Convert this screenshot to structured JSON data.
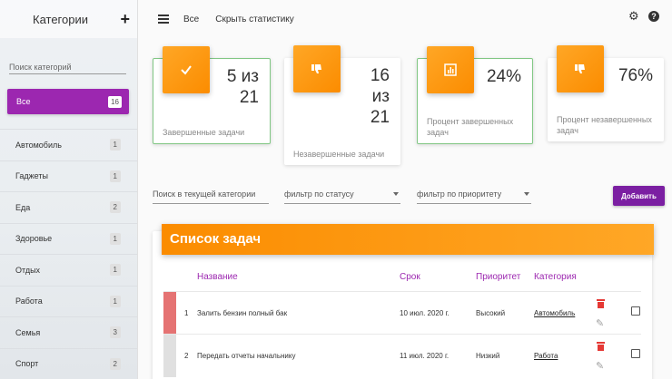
{
  "sidebar": {
    "title": "Категории",
    "add_icon": "plus-icon",
    "search_placeholder": "Поиск категорий",
    "all": {
      "label": "Все",
      "count": "16"
    },
    "items": [
      {
        "label": "Автомобиль",
        "count": "1"
      },
      {
        "label": "Гаджеты",
        "count": "1"
      },
      {
        "label": "Еда",
        "count": "2"
      },
      {
        "label": "Здоровье",
        "count": "1"
      },
      {
        "label": "Отдых",
        "count": "1"
      },
      {
        "label": "Работа",
        "count": "1"
      },
      {
        "label": "Семья",
        "count": "3"
      },
      {
        "label": "Спорт",
        "count": "2"
      }
    ]
  },
  "topbar": {
    "menu_icon": "menu-icon",
    "current": "Все",
    "toggle_stats": "Скрыть статистику",
    "settings_icon": "gear-icon",
    "help_icon": "help-icon",
    "help_glyph": "?"
  },
  "stats": {
    "completed": {
      "value": "5 из 21",
      "label": "Завершенные задачи",
      "icon": "check-icon"
    },
    "uncompleted": {
      "value": "16 из 21",
      "label": "Незавершенные задачи",
      "icon": "thumb-down-icon"
    },
    "completed_pct": {
      "value": "24%",
      "label": "Процент завершенных задач",
      "icon": "bar-chart-icon"
    },
    "uncompleted_pct": {
      "value": "76%",
      "label": "Процент незавершенных задач",
      "icon": "thumb-down-icon"
    }
  },
  "filters": {
    "search_placeholder": "Поиск в текущей категории",
    "status_placeholder": "фильтр по статусу",
    "priority_placeholder": "фильтр по приоритету",
    "add_label": "Добавить"
  },
  "tasks": {
    "title": "Список задач",
    "columns": {
      "name": "Название",
      "date": "Срок",
      "priority": "Приоритет",
      "category": "Категория"
    },
    "rows": [
      {
        "num": "1",
        "name": "Залить бензин полный бак",
        "date": "10 июл. 2020 г.",
        "priority": "Высокий",
        "category": "Автомобиль",
        "priority_color": "#e57373"
      },
      {
        "num": "2",
        "name": "Передать отчеты начальнику",
        "date": "11 июл. 2020 г.",
        "priority": "Низкий",
        "category": "Работа",
        "priority_color": "#e0e0e0"
      }
    ]
  }
}
